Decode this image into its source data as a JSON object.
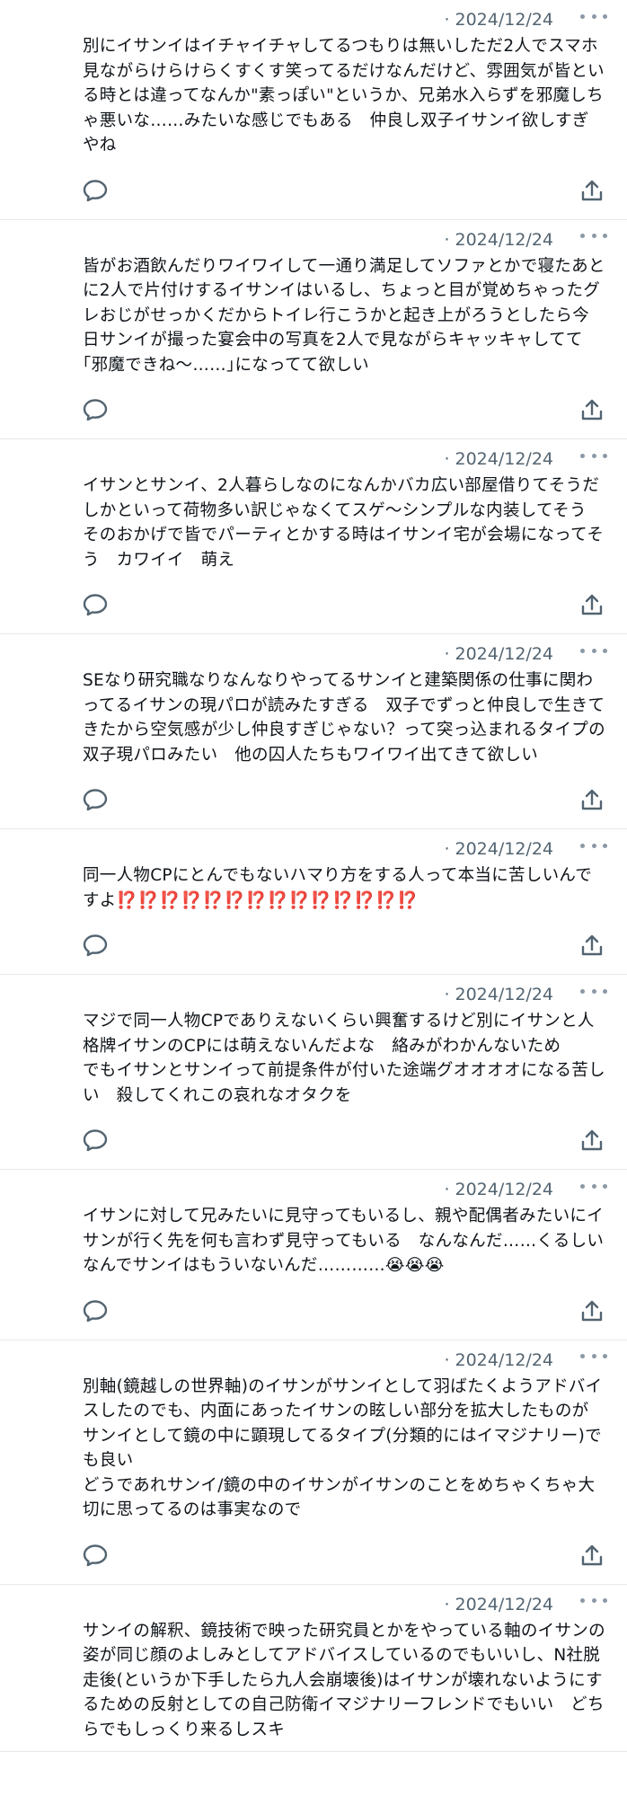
{
  "icons": {
    "reply": "speech-bubble-icon",
    "share": "share-upload-icon",
    "more": "more-dots-icon"
  },
  "colors": {
    "text": "#0f1419",
    "secondary": "#536471",
    "divider": "#e6e9ec",
    "emoji_accent": "#e0245e"
  },
  "tweets": [
    {
      "date": "2024/12/24",
      "text": "別にイサンイはイチャイチャしてるつもりは無いしただ2人でスマホ見ながらけらけらくすくす笑ってるだけなんだけど、雰囲気が皆といる時とは違ってなんか\"素っぽい\"というか、兄弟水入らずを邪魔しちゃ悪いな……みたいな感じでもある　仲良し双子イサンイ欲しすぎやね"
    },
    {
      "date": "2024/12/24",
      "text": "皆がお酒飲んだりワイワイして一通り満足してソファとかで寝たあとに2人で片付けするイサンイはいるし、ちょっと目が覚めちゃったグレおじがせっかくだからトイレ行こうかと起き上がろうとしたら今日サンイが撮った宴会中の写真を2人で見ながらキャッキャしてて｢邪魔できね〜……｣になってて欲しい"
    },
    {
      "date": "2024/12/24",
      "text": "イサンとサンイ、2人暮らしなのになんかバカ広い部屋借りてそうだしかといって荷物多い訳じゃなくてスゲ〜シンプルな内装してそう　そのおかげで皆でパーティとかする時はイサンイ宅が会場になってそう　カワイイ　萌え"
    },
    {
      "date": "2024/12/24",
      "text": "SEなり研究職なりなんなりやってるサンイと建築関係の仕事に関わってるイサンの現パロが読みたすぎる　双子でずっと仲良しで生きてきたから空気感が少し仲良すぎじゃない？って突っ込まれるタイプの双子現パロみたい　他の囚人たちもワイワイ出てきて欲しい"
    },
    {
      "date": "2024/12/24",
      "text": "同一人物CPにとんでもないハマり方をする人って本当に苦しいんですよ",
      "emoji": "⁉️⁉️⁉️⁉️⁉️⁉️⁉️⁉️⁉️⁉️⁉️⁉️⁉️⁉️"
    },
    {
      "date": "2024/12/24",
      "text": "マジで同一人物CPでありえないくらい興奮するけど別にイサンと人格牌イサンのCPには萌えないんだよな　絡みがわかんないため\nでもイサンとサンイって前提条件が付いた途端グオオオオになる苦しい　殺してくれこの哀れなオタクを"
    },
    {
      "date": "2024/12/24",
      "text": "イサンに対して兄みたいに見守ってもいるし、親や配偶者みたいにイサンが行く先を何も言わず見守ってもいる　なんなんだ……くるしい　なんでサンイはもういないんだ…………",
      "emoji": "😭😭😭"
    },
    {
      "date": "2024/12/24",
      "text": "別軸(鏡越しの世界軸)のイサンがサンイとして羽ばたくようアドバイスしたのでも、内面にあったイサンの眩しい部分を拡大したものがサンイとして鏡の中に顕現してるタイプ(分類的にはイマジナリー)でも良い\nどうであれサンイ/鏡の中のイサンがイサンのことをめちゃくちゃ大切に思ってるのは事実なので"
    },
    {
      "date": "2024/12/24",
      "text": "サンイの解釈、鏡技術で映った研究員とかをやっている軸のイサンの姿が同じ顔のよしみとしてアドバイスしているのでもいいし、N社脱走後(というか下手したら九人会崩壊後)はイサンが壊れないようにするための反射としての自己防衛イマジナリーフレンドでもいい　どちらでもしっくり来るしスキ"
    }
  ]
}
